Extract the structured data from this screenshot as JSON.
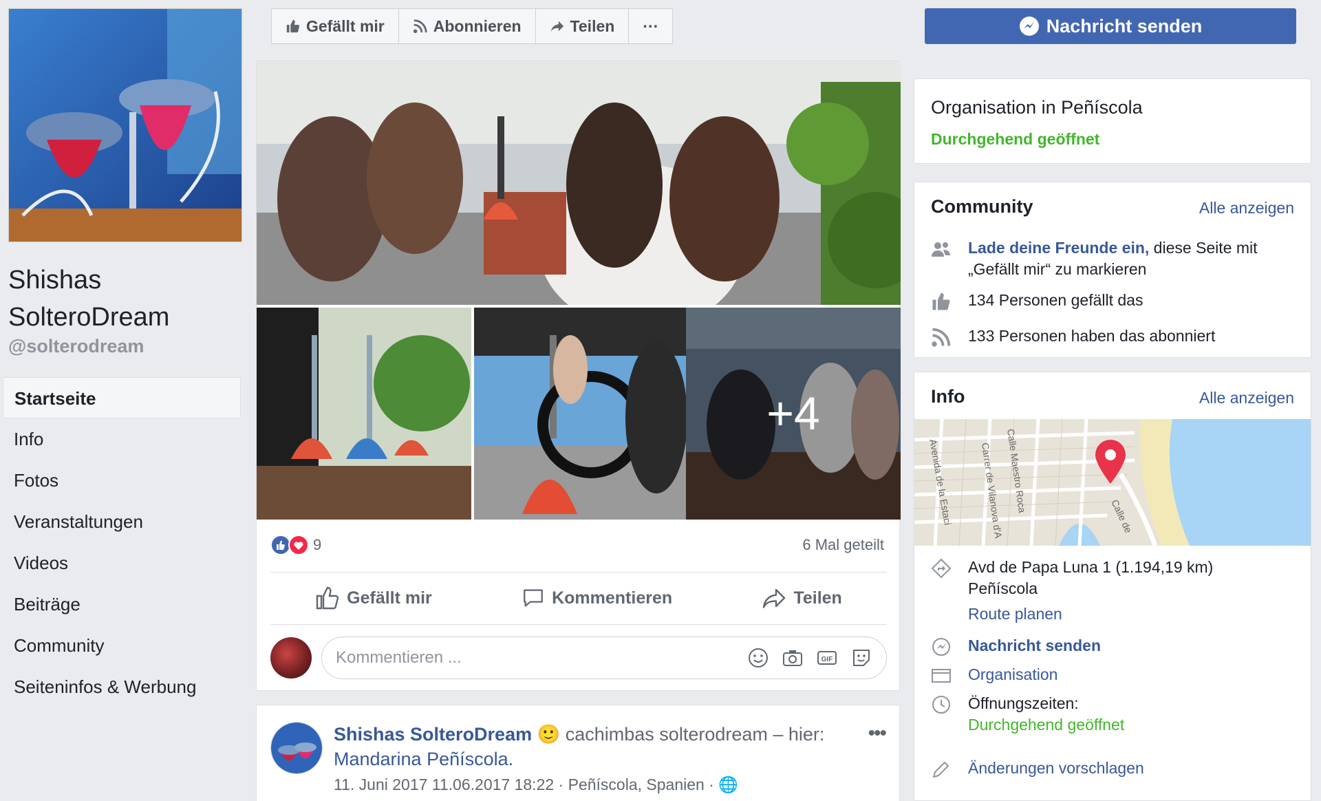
{
  "page": {
    "name_line1": "Shishas",
    "name_line2": "SolteroDream",
    "handle": "@solterodream"
  },
  "nav": {
    "items": [
      {
        "label": "Startseite",
        "active": true
      },
      {
        "label": "Info"
      },
      {
        "label": "Fotos"
      },
      {
        "label": "Veranstaltungen"
      },
      {
        "label": "Videos"
      },
      {
        "label": "Beiträge"
      },
      {
        "label": "Community"
      },
      {
        "label": "Seiteninfos & Werbung"
      }
    ]
  },
  "actionbar": {
    "like": "Gefällt mir",
    "follow": "Abonnieren",
    "share": "Teilen",
    "more": "···",
    "message": "Nachricht senden"
  },
  "post": {
    "more_photos": "+4",
    "reaction_count": "9",
    "shares": "6 Mal geteilt",
    "actions": {
      "like": "Gefällt mir",
      "comment": "Kommentieren",
      "share": "Teilen"
    },
    "comment_placeholder": "Kommentieren ..."
  },
  "post2": {
    "author": "Shishas SolteroDream",
    "text": " cachimbas solterodream – hier: ",
    "place": "Mandarina Peñíscola.",
    "date": "11. Juni 2017 11.06.2017 18:22",
    "location": "Peñíscola, Spanien",
    "separator": " · "
  },
  "sidebar": {
    "category": "Organisation in Peñíscola",
    "open_status": "Durchgehend geöffnet",
    "community": {
      "title": "Community",
      "see_all": "Alle anzeigen",
      "invite_link": "Lade deine Freunde ein,",
      "invite_text": " diese Seite mit „Gefällt mir“ zu markieren",
      "likes": "134 Personen gefällt das",
      "follows": "133 Personen haben das abonniert"
    },
    "info": {
      "title": "Info",
      "see_all": "Alle anzeigen",
      "address_line1": "Avd de Papa Luna 1 (1.194,19 km)",
      "address_line2": "Peñíscola",
      "route": "Route planen",
      "message": "Nachricht senden",
      "category": "Organisation",
      "hours_label": "Öffnungszeiten:",
      "hours_value": "Durchgehend geöffnet",
      "suggest": "Änderungen vorschlagen"
    },
    "map_labels": {
      "street1": "Avenida de la Estaci",
      "street2": "Carrer de Vilanova d'A",
      "street3": "Calle Maestro Roca",
      "street4": "Calle de"
    }
  },
  "colors": {
    "brand_blue": "#4267b2",
    "link_blue": "#385898",
    "open_green": "#42b72a",
    "background": "#e9ebee"
  }
}
